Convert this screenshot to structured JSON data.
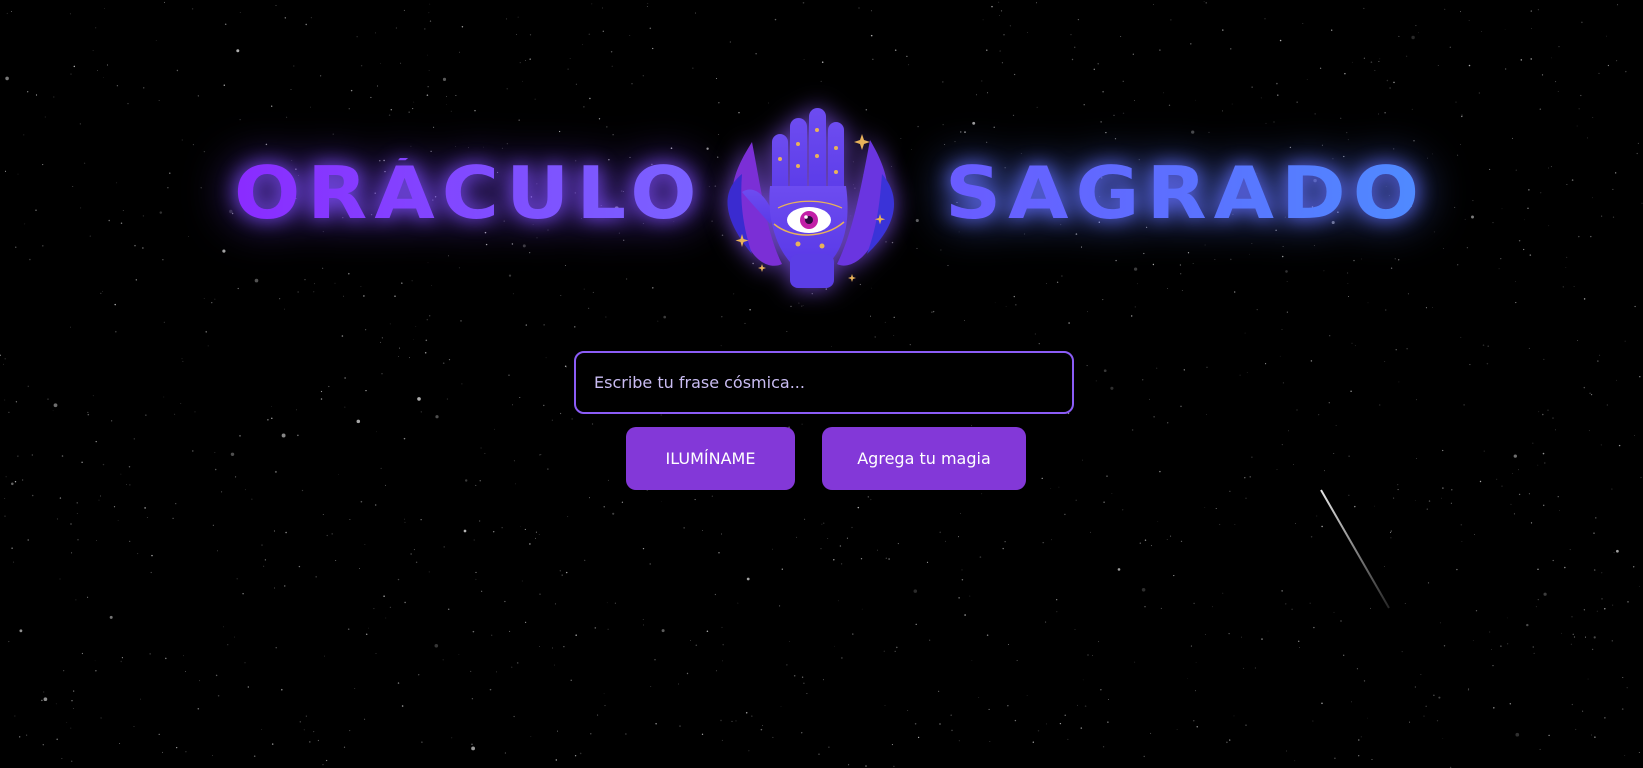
{
  "header": {
    "title_left": "ORÁCULO",
    "title_right": "SAGRADO",
    "logo_icon": "mystic-hand-eye-icon"
  },
  "oracle_form": {
    "input_value": "",
    "input_placeholder": "Escribe tu frase cósmica...",
    "illuminate_label": "ILUMÍNAME",
    "add_magic_label": "Agrega tu magia"
  },
  "colors": {
    "background": "#000000",
    "accent_purple": "#8338d8",
    "input_border": "#8b5cf6",
    "title_gradient_start": "#8a2bff",
    "title_gradient_end": "#4f8bff"
  }
}
